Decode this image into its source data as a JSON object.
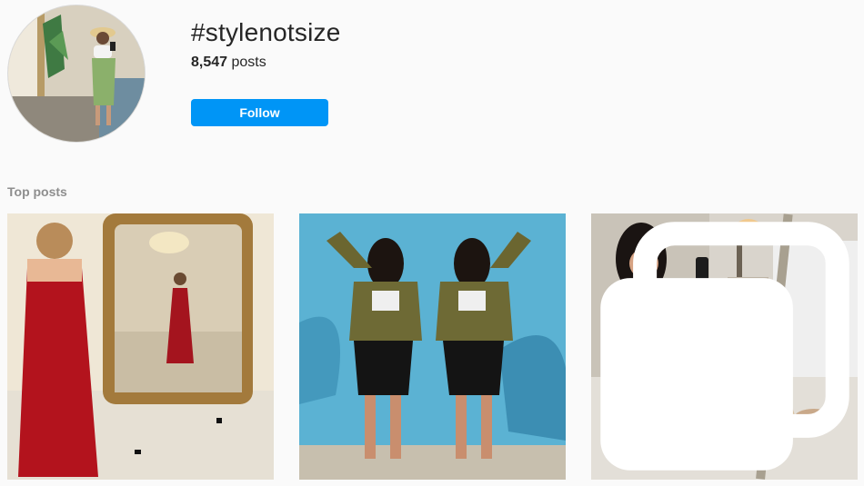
{
  "header": {
    "hashtag": "#stylenotsize",
    "post_count": "8,547",
    "post_count_suffix": "posts",
    "follow_label": "Follow",
    "follow_color": "#0095f6"
  },
  "top_posts": {
    "label": "Top posts",
    "posts": [
      {
        "type": "photo",
        "badge": ""
      },
      {
        "type": "photo",
        "badge": ""
      },
      {
        "type": "photo",
        "badge": "carousel-icon"
      }
    ]
  }
}
